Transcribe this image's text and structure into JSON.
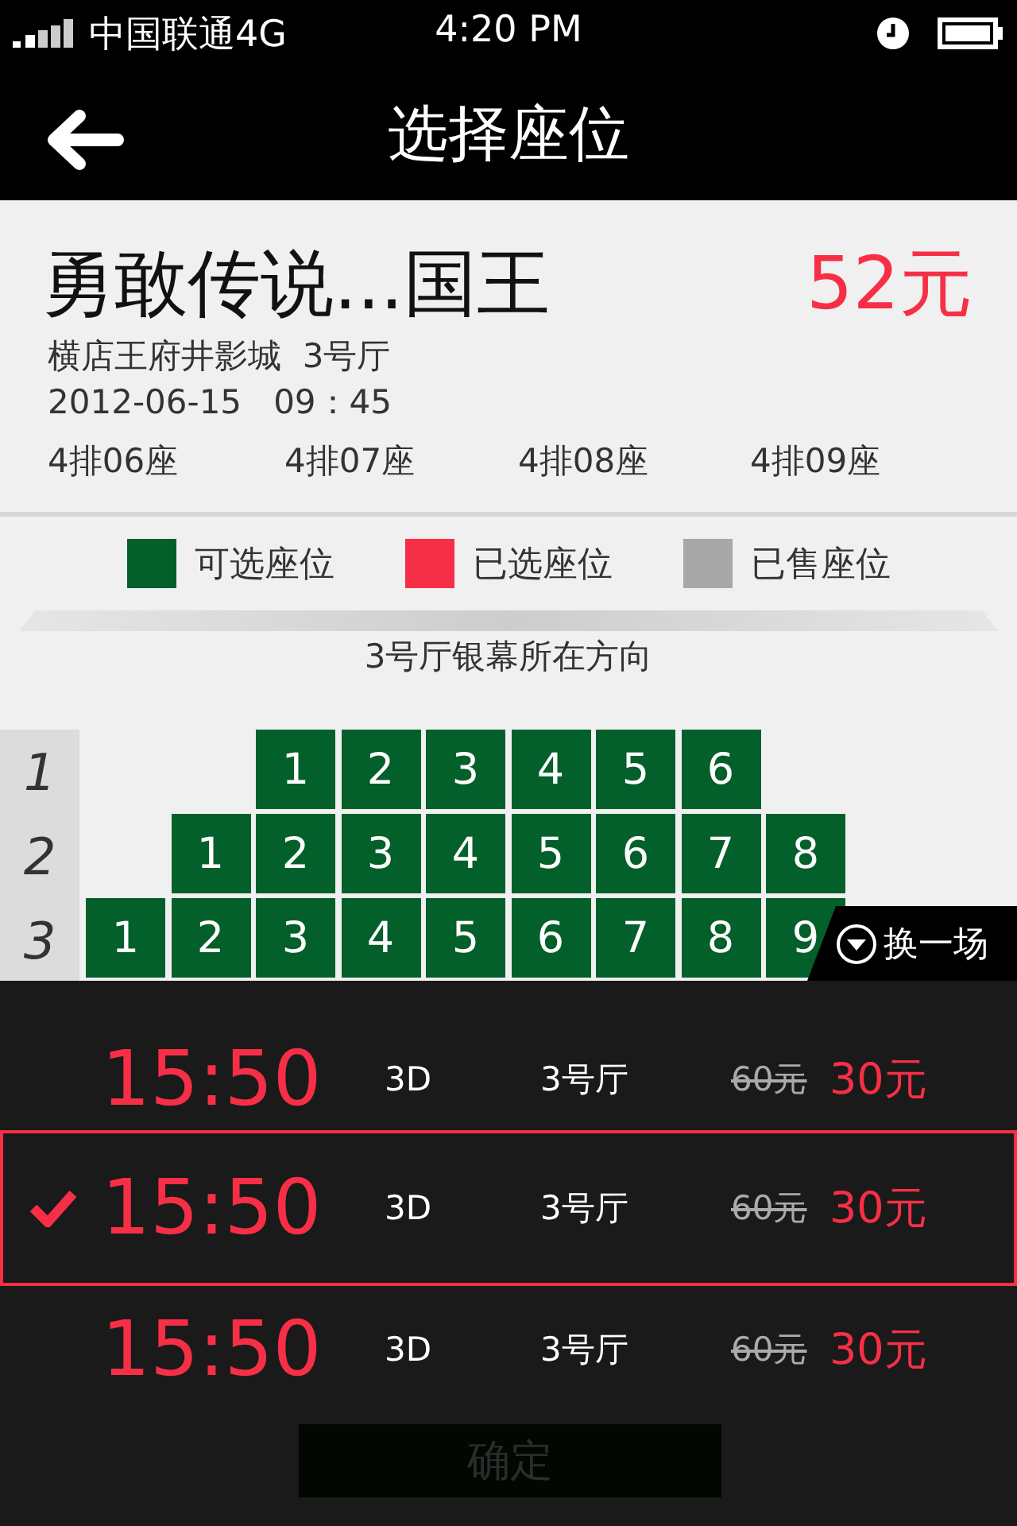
{
  "status_bar": {
    "carrier": "中国联通4G",
    "time": "4:20 PM"
  },
  "nav": {
    "title": "选择座位"
  },
  "movie": {
    "title": "勇敢传说...国王",
    "price": "52元",
    "cinema": "横店王府井影城  3号厅",
    "datetime": "2012-06-15   09：45",
    "chosen_seats": [
      "4排06座",
      "4排07座",
      "4排08座",
      "4排09座"
    ]
  },
  "legend": [
    {
      "label": "可选座位",
      "color": "#04602a"
    },
    {
      "label": "已选座位",
      "color": "#f72f46"
    },
    {
      "label": "已售座位",
      "color": "#a8a8a8"
    }
  ],
  "screen_caption": "3号厅银幕所在方向",
  "seat_rows": [
    {
      "label": "1",
      "seats": [
        "1",
        "2",
        "3",
        "4",
        "5",
        "6"
      ]
    },
    {
      "label": "2",
      "seats": [
        "1",
        "2",
        "3",
        "4",
        "5",
        "6",
        "7",
        "8"
      ]
    },
    {
      "label": "3",
      "seats": [
        "1",
        "2",
        "3",
        "4",
        "5",
        "6",
        "7",
        "8",
        "9"
      ]
    }
  ],
  "change_show": {
    "label": "换一场"
  },
  "showtimes": [
    {
      "time": "15:50",
      "format": "3D",
      "hall": "3号厅",
      "original_price": "60元",
      "price": "30元",
      "selected": false
    },
    {
      "time": "15:50",
      "format": "3D",
      "hall": "3号厅",
      "original_price": "60元",
      "price": "30元",
      "selected": true
    },
    {
      "time": "15:50",
      "format": "3D",
      "hall": "3号厅",
      "original_price": "60元",
      "price": "30元",
      "selected": false
    }
  ],
  "confirm": {
    "label": "确定",
    "disabled": true
  }
}
